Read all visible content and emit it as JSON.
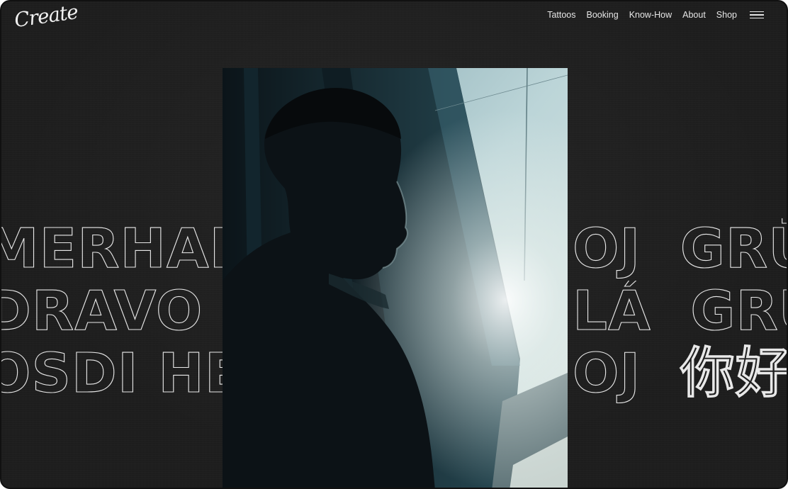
{
  "brand": {
    "logo_text": "Create"
  },
  "nav": {
    "items": [
      "Tattoos",
      "Booking",
      "Know-How",
      "About",
      "Shop"
    ]
  },
  "menu": {
    "icon": "hamburger-menu-icon"
  },
  "marquee": {
    "line1": "AHOJ GRÜEZI SERVUS MERHABA HALLO AHOJ GRÜEZI SERVUS MERHABA HALLO AHOJ",
    "line2": "DOBRÝ DEN ZDRAVO ZDRAVOJ HOLÁ GRÜSS GOTT ZDRAVO HOLÁ",
    "line3": "HOLA ZDRAVO MOSDI HEJ AHOJ 你好 SERVUS MOSDI HEJ AHOJ 你好"
  },
  "hero": {
    "image": "portrait-photo",
    "palette": {
      "sky": "#b9d3d6",
      "shadow": "#0b1117",
      "teal": "#2f5865"
    }
  },
  "colors": {
    "background": "#1e1e1e",
    "text": "#e6e6e6"
  }
}
